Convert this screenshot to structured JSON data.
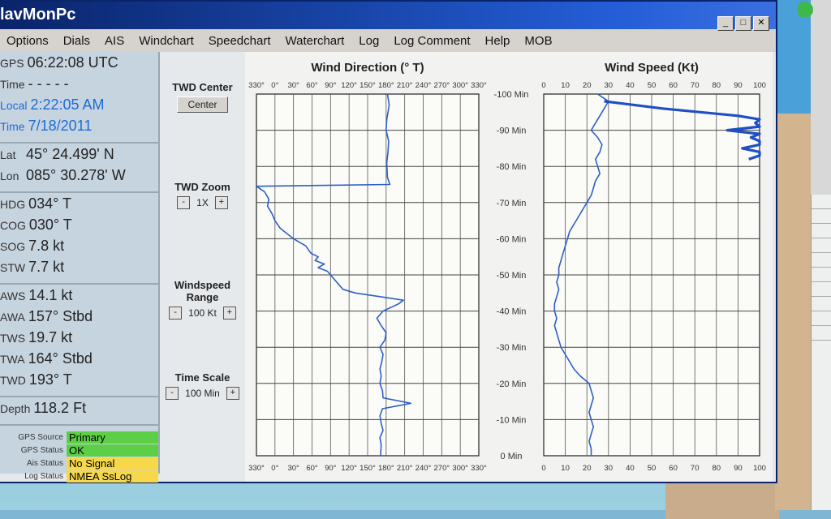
{
  "app": {
    "title": "lavMonPc"
  },
  "window_buttons": [
    "_",
    "□",
    "✕"
  ],
  "menu": [
    "Options",
    "Dials",
    "AIS",
    "Windchart",
    "Speedchart",
    "Waterchart",
    "Log",
    "Log Comment",
    "Help",
    "MOB"
  ],
  "left": {
    "gps": {
      "label": "GPS",
      "value": "06:22:08 UTC"
    },
    "time": {
      "label": "Time",
      "value": "- - - - -"
    },
    "local_time": {
      "label": "Local",
      "value": "2:22:05 AM"
    },
    "local_date": {
      "label": "Time",
      "value": "7/18/2011"
    },
    "lat": {
      "label": "Lat",
      "value": "45° 24.499' N"
    },
    "lon": {
      "label": "Lon",
      "value": "085° 30.278' W"
    },
    "hdg": {
      "label": "HDG",
      "value": "034° T"
    },
    "cog": {
      "label": "COG",
      "value": "030° T"
    },
    "sog": {
      "label": "SOG",
      "value": "7.8 kt"
    },
    "stw": {
      "label": "STW",
      "value": "7.7 kt"
    },
    "aws": {
      "label": "AWS",
      "value": "14.1 kt"
    },
    "awa": {
      "label": "AWA",
      "value": "157° Stbd"
    },
    "tws": {
      "label": "TWS",
      "value": "19.7 kt"
    },
    "twa": {
      "label": "TWA",
      "value": "164° Stbd"
    },
    "twd": {
      "label": "TWD",
      "value": "193° T"
    },
    "depth": {
      "label": "Depth",
      "value": "118.2 Ft"
    },
    "status": [
      {
        "label": "GPS Source",
        "value": "Primary",
        "color": "#5ccf46"
      },
      {
        "label": "GPS Status",
        "value": "OK",
        "color": "#5ccf46"
      },
      {
        "label": "Ais Status",
        "value": "No Signal",
        "color": "#f6d84a"
      },
      {
        "label": "Log Status",
        "value": "NMEA    SsLog",
        "color": "#f6d84a"
      }
    ]
  },
  "controls": {
    "twd_center_title": "TWD Center",
    "center_button": "Center",
    "twd_zoom_title": "TWD Zoom",
    "twd_zoom_value": "1X",
    "windspeed_range_title": "Windspeed Range",
    "windspeed_range_value": "100 Kt",
    "time_scale_title": "Time Scale",
    "time_scale_value": "100 Min",
    "minus": "-",
    "plus": "+"
  },
  "chart_data": [
    {
      "type": "line",
      "title": "Wind Direction (° T)",
      "x_ticks": [
        "330°",
        "0°",
        "30°",
        "60°",
        "90°",
        "120°",
        "150°",
        "180°",
        "210°",
        "240°",
        "270°",
        "300°",
        "330°"
      ],
      "xlim": [
        330,
        690
      ],
      "y_ticks": [
        "-100 Min",
        "-90 Min",
        "-80 Min",
        "-70 Min",
        "-60 Min",
        "-50 Min",
        "-40 Min",
        "-30 Min",
        "-20 Min",
        "-10 Min",
        "0 Min"
      ],
      "ylim": [
        -100,
        0
      ],
      "series": [
        {
          "color": "#2d5fc7",
          "points": [
            [
              -100,
              542
            ],
            [
              -97,
              545
            ],
            [
              -93,
              541
            ],
            [
              -90,
              540
            ],
            [
              -87,
              544
            ],
            [
              -84,
              543
            ],
            [
              -81,
              541
            ],
            [
              -77,
              542
            ],
            [
              -75,
              546
            ],
            [
              -74.5,
              330
            ],
            [
              -73,
              343
            ],
            [
              -71,
              350
            ],
            [
              -69,
              348
            ],
            [
              -67,
              355
            ],
            [
              -65,
              360
            ],
            [
              -63,
              368
            ],
            [
              -62,
              375
            ],
            [
              -60,
              390
            ],
            [
              -58,
              410
            ],
            [
              -56,
              418
            ],
            [
              -55,
              430
            ],
            [
              -54,
              425
            ],
            [
              -53,
              440
            ],
            [
              -52,
              430
            ],
            [
              -51,
              445
            ],
            [
              -50,
              450
            ],
            [
              -48,
              460
            ],
            [
              -46,
              470
            ],
            [
              -45,
              490
            ],
            [
              -44,
              530
            ],
            [
              -43,
              568
            ],
            [
              -42,
              560
            ],
            [
              -40,
              535
            ],
            [
              -38,
              525
            ],
            [
              -36,
              532
            ],
            [
              -34,
              540
            ],
            [
              -32,
              538
            ],
            [
              -30,
              530
            ],
            [
              -28,
              535
            ],
            [
              -26,
              533
            ],
            [
              -24,
              530
            ],
            [
              -22,
              532
            ],
            [
              -20,
              530
            ],
            [
              -18,
              534
            ],
            [
              -16,
              535
            ],
            [
              -14.5,
              580
            ],
            [
              -13,
              534
            ],
            [
              -11,
              530
            ],
            [
              -9,
              532
            ],
            [
              -7,
              535
            ],
            [
              -5,
              530
            ],
            [
              -3,
              532
            ],
            [
              0,
              531
            ]
          ]
        }
      ]
    },
    {
      "type": "line",
      "title": "Wind Speed (Kt)",
      "x_ticks": [
        "0",
        "10",
        "20",
        "30",
        "40",
        "50",
        "60",
        "70",
        "80",
        "90",
        "100"
      ],
      "xlim": [
        0,
        100
      ],
      "y_ticks": [
        "-100 Min",
        "-90 Min",
        "-80 Min",
        "-70 Min",
        "-60 Min",
        "-50 Min",
        "-40 Min",
        "-30 Min",
        "-20 Min",
        "-10 Min",
        "0 Min"
      ],
      "ylim": [
        -100,
        0
      ],
      "series": [
        {
          "color": "#2d5fc7",
          "points": [
            [
              -100,
              25
            ],
            [
              -98,
              30
            ],
            [
              -96,
              28
            ],
            [
              -94,
              26
            ],
            [
              -92,
              24
            ],
            [
              -90,
              22
            ],
            [
              -88,
              25
            ],
            [
              -86,
              27
            ],
            [
              -84,
              26
            ],
            [
              -82,
              24
            ],
            [
              -80,
              25
            ],
            [
              -78,
              26
            ],
            [
              -76,
              24
            ],
            [
              -74,
              23
            ],
            [
              -72,
              22
            ],
            [
              -70,
              20
            ],
            [
              -68,
              18
            ],
            [
              -66,
              16
            ],
            [
              -64,
              14
            ],
            [
              -62,
              12
            ],
            [
              -60,
              11
            ],
            [
              -58,
              10
            ],
            [
              -56,
              9
            ],
            [
              -54,
              8
            ],
            [
              -52,
              7
            ],
            [
              -50,
              7
            ],
            [
              -48,
              6
            ],
            [
              -46,
              7
            ],
            [
              -44,
              6
            ],
            [
              -42,
              5
            ],
            [
              -40,
              5
            ],
            [
              -38,
              6
            ],
            [
              -36,
              5
            ],
            [
              -34,
              6
            ],
            [
              -32,
              7
            ],
            [
              -30,
              8
            ],
            [
              -28,
              10
            ],
            [
              -26,
              12
            ],
            [
              -24,
              14
            ],
            [
              -22,
              17
            ],
            [
              -20,
              21
            ],
            [
              -18,
              22
            ],
            [
              -16,
              23
            ],
            [
              -14,
              22
            ],
            [
              -12,
              21
            ],
            [
              -10,
              22
            ],
            [
              -8,
              23
            ],
            [
              -6,
              22
            ],
            [
              -4,
              21
            ],
            [
              -2,
              22
            ],
            [
              0,
              22
            ]
          ]
        },
        {
          "color": "#1e4fc4",
          "points": [
            [
              -98,
              28
            ],
            [
              -96,
              55
            ],
            [
              -94,
              90
            ],
            [
              -93,
              100
            ],
            [
              -92,
              98
            ],
            [
              -91,
              100
            ],
            [
              -90,
              85
            ],
            [
              -89,
              100
            ],
            [
              -88,
              96
            ],
            [
              -87,
              100
            ],
            [
              -86,
              100
            ],
            [
              -85,
              92
            ],
            [
              -84,
              100
            ],
            [
              -83,
              100
            ],
            [
              -82,
              95
            ]
          ]
        }
      ]
    }
  ]
}
